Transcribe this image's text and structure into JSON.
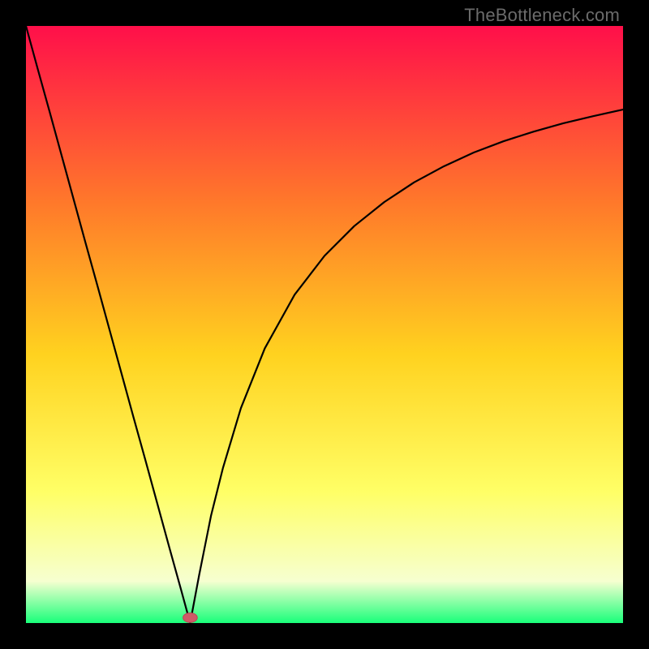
{
  "watermark": "TheBottleneck.com",
  "colors": {
    "frame": "#000000",
    "curve": "#000000",
    "marker_fill": "#cf5a67",
    "marker_stroke": "#b84a56",
    "grad_top": "#ff0f4a",
    "grad_mid_upper": "#ff7a2a",
    "grad_mid": "#ffd21f",
    "grad_mid_lower": "#ffff66",
    "grad_lower": "#f6ffd0",
    "grad_bottom": "#19ff7a"
  },
  "chart_data": {
    "type": "line",
    "title": "",
    "xlabel": "",
    "ylabel": "",
    "xlim": [
      0,
      100
    ],
    "ylim": [
      0,
      100
    ],
    "legend": false,
    "grid": false,
    "series": [
      {
        "name": "left-branch",
        "x": [
          0,
          2,
          4,
          6,
          8,
          10,
          12,
          14,
          16,
          18,
          20,
          22,
          24,
          26,
          27.5
        ],
        "values": [
          100,
          92.7,
          85.5,
          78.2,
          70.9,
          63.6,
          56.4,
          49.1,
          41.8,
          34.5,
          27.3,
          20,
          12.7,
          5.5,
          0
        ]
      },
      {
        "name": "right-branch",
        "x": [
          27.5,
          29,
          31,
          33,
          36,
          40,
          45,
          50,
          55,
          60,
          65,
          70,
          75,
          80,
          85,
          90,
          95,
          100
        ],
        "values": [
          0,
          8,
          18,
          26,
          36,
          46,
          55,
          61.5,
          66.5,
          70.5,
          73.8,
          76.5,
          78.8,
          80.7,
          82.3,
          83.7,
          84.9,
          86
        ]
      }
    ],
    "marker": {
      "x": 27.5,
      "y": 0.9,
      "rx": 1.2,
      "ry": 0.8
    },
    "gradient_stops": [
      {
        "offset": 0,
        "value": 100
      },
      {
        "offset": 0.3,
        "value": 70
      },
      {
        "offset": 0.55,
        "value": 45
      },
      {
        "offset": 0.78,
        "value": 22
      },
      {
        "offset": 0.93,
        "value": 7
      },
      {
        "offset": 1.0,
        "value": 0
      }
    ]
  }
}
